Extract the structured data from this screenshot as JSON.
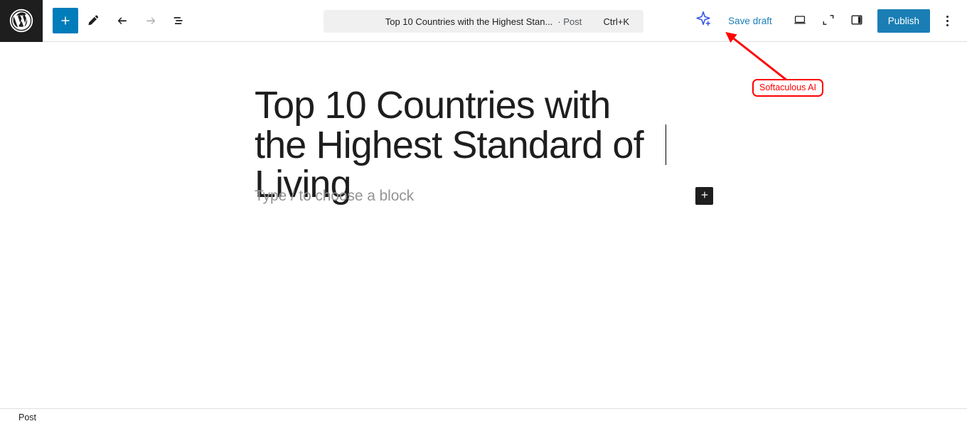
{
  "header": {
    "logo_icon": "wordpress-logo-icon",
    "tools": [
      {
        "name": "add-block-button",
        "icon": "plus-icon",
        "label": "Add block"
      },
      {
        "name": "edit-tool-button",
        "icon": "pencil-icon",
        "label": "Tools"
      },
      {
        "name": "undo-button",
        "icon": "undo-arrow-icon",
        "label": "Undo"
      },
      {
        "name": "redo-button",
        "icon": "redo-arrow-icon",
        "label": "Redo"
      },
      {
        "name": "document-overview-button",
        "icon": "list-view-icon",
        "label": "Document Overview"
      }
    ],
    "command_bar": {
      "title": "Top 10 Countries with the Highest Stan...",
      "separator": "· Post",
      "shortcut": "Ctrl+K"
    },
    "ai_button_label": "Softaculous AI",
    "save_draft_label": "Save draft",
    "view_icons": [
      {
        "name": "device-preview-button",
        "icon": "desktop-icon"
      },
      {
        "name": "fullscreen-preview-button",
        "icon": "expand-corners-icon"
      },
      {
        "name": "settings-sidebar-toggle",
        "icon": "sidebar-panel-icon"
      }
    ],
    "publish_label": "Publish",
    "options_icon": "kebab-menu-icon"
  },
  "editor": {
    "post_title": "Top 10 Countries with the Highest Standard of Living",
    "block_placeholder": "Type / to choose a block",
    "inserter_icon": "plus-icon"
  },
  "footer": {
    "breadcrumb": "Post"
  },
  "annotation": {
    "label": "Softaculous AI"
  },
  "colors": {
    "brand_blue": "#007cba",
    "publish_blue": "#1a7eb5",
    "dark": "#1e1e1e",
    "annotation_red": "#ff0000",
    "ai_icon_blue": "#3858e9"
  }
}
